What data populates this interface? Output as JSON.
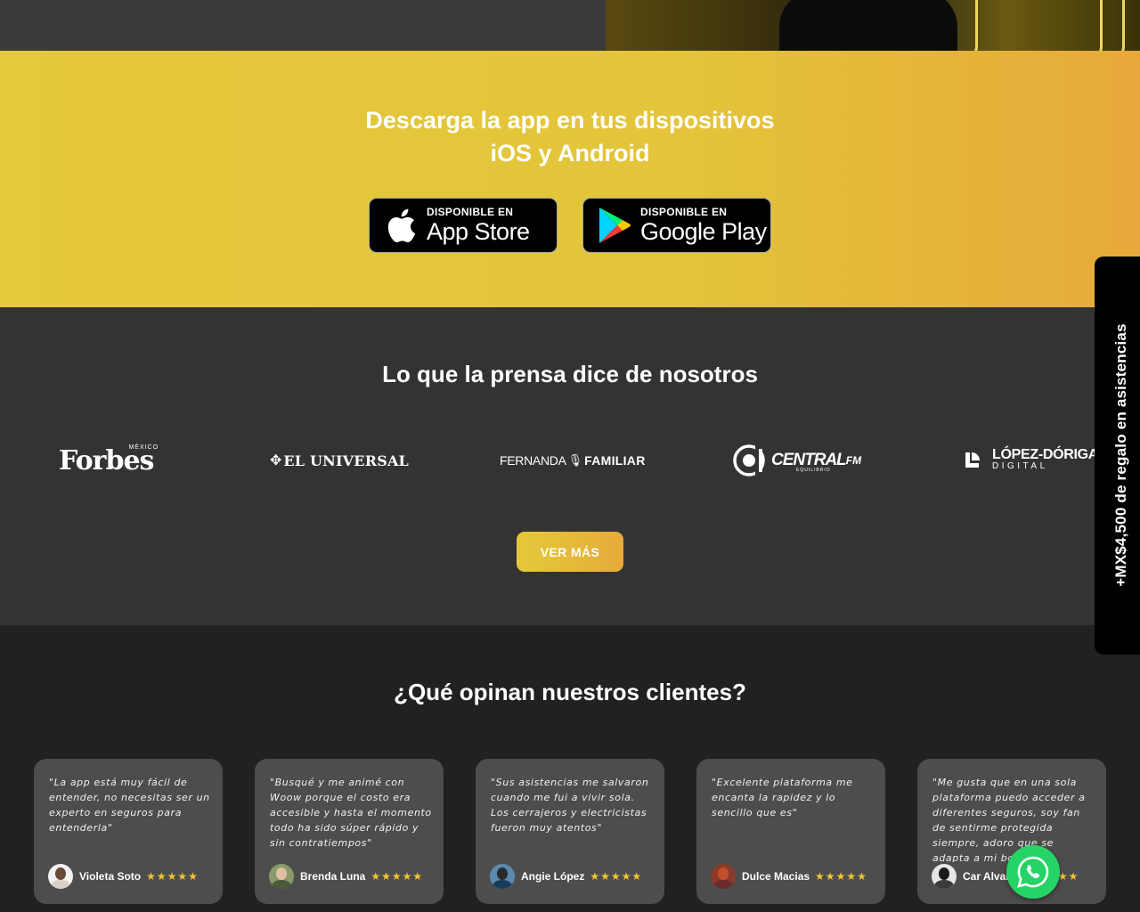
{
  "app_section": {
    "title_line1": "Descarga la app en tus dispositivos",
    "title_line2": "iOS y Android",
    "app_store": {
      "small": "DISPONIBLE EN",
      "big": "App Store",
      "icon": "apple-icon"
    },
    "google_play": {
      "small": "DISPONIBLE EN",
      "big": "Google Play",
      "icon": "google-play-icon"
    }
  },
  "press_section": {
    "title": "Lo que la prensa dice de nosotros",
    "logos": {
      "forbes": {
        "name": "Forbes",
        "sub": "MÉXICO"
      },
      "el_universal": {
        "name": "EL UNIVERSAL"
      },
      "fernanda_familiar": {
        "left": "FERNANDA",
        "right": "FAMILIAR"
      },
      "central_fm": {
        "name": "CENTRAL",
        "suffix": "FM",
        "sub": "EQUILIBRIO"
      },
      "lopez_doriga": {
        "name": "LÓPEZ-DÓRIGA",
        "sub": "DIGITAL"
      }
    },
    "ver_mas": "VER MÁS"
  },
  "reviews_section": {
    "title": "¿Qué opinan nuestros clientes?",
    "reviews": [
      {
        "text": "\"La app está muy fácil de entender, no necesitas ser un experto en seguros para entenderla\"",
        "name": "Violeta Soto",
        "stars": "★★★★★"
      },
      {
        "text": "\"Busqué y me animé con Woow porque el costo era accesible y hasta el momento todo ha sido súper rápido y sin contratiempos\"",
        "name": "Brenda Luna",
        "stars": "★★★★★"
      },
      {
        "text": "\"Sus asistencias me salvaron cuando me fui a vivir sola. Los cerrajeros y electricistas fueron muy atentos\"",
        "name": "Angie López",
        "stars": "★★★★★"
      },
      {
        "text": "\"Excelente plataforma me encanta la rapidez y lo sencillo que es\"",
        "name": "Dulce Macias",
        "stars": "★★★★★"
      },
      {
        "text": "\"Me gusta que en una sola plataforma puedo acceder a diferentes seguros, soy fan de sentirme protegida siempre, adoro que se adapta a mi bolsillo\"",
        "name": "Car Alvarez",
        "stars": "★★★★★"
      }
    ]
  },
  "side_tab": {
    "label": "+MX$4,500 de regalo en asistencias"
  },
  "whatsapp": {
    "icon": "whatsapp-icon"
  },
  "colors": {
    "accent_yellow": "#e4c93a",
    "accent_orange": "#e7a93a",
    "dark": "#333333",
    "darker": "#212121",
    "star": "#f4c430",
    "whatsapp": "#25d366"
  }
}
